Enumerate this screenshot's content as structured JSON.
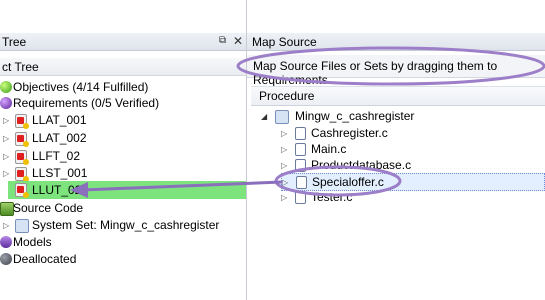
{
  "left_panel": {
    "title": "Tree",
    "tree_header": "ct Tree",
    "items": [
      {
        "label": "Objectives (4/14 Fulfilled)",
        "icon": "objectives-icon"
      },
      {
        "label": "Requirements (0/5 Verified)",
        "icon": "requirements-icon"
      },
      {
        "label": "LLAT_001",
        "icon": "requirement-item-icon"
      },
      {
        "label": "LLAT_002",
        "icon": "requirement-item-icon"
      },
      {
        "label": "LLFT_02",
        "icon": "requirement-item-icon"
      },
      {
        "label": "LLST_001",
        "icon": "requirement-item-icon"
      },
      {
        "label": "LLUT_02",
        "icon": "requirement-item-icon"
      },
      {
        "label": "Source Code",
        "icon": "source-code-icon"
      },
      {
        "label": "System Set: Mingw_c_cashregister",
        "icon": "system-set-icon"
      },
      {
        "label": "Models",
        "icon": "models-icon"
      },
      {
        "label": "Deallocated",
        "icon": "deallocated-icon"
      }
    ]
  },
  "right_panel": {
    "title": "Map Source",
    "hint": "Map Source Files or Sets by dragging them to Requirements",
    "procedure_header": "Procedure",
    "root": "Mingw_c_cashregister",
    "files": [
      "Cashregister.c",
      "Main.c",
      "Productdatabase.c",
      "Specialoffer.c",
      "Tester.c"
    ]
  },
  "colors": {
    "highlight_green": "#7de47d",
    "annotation_purple": "#9c7fc8",
    "arrow": "#8a6fbd"
  }
}
